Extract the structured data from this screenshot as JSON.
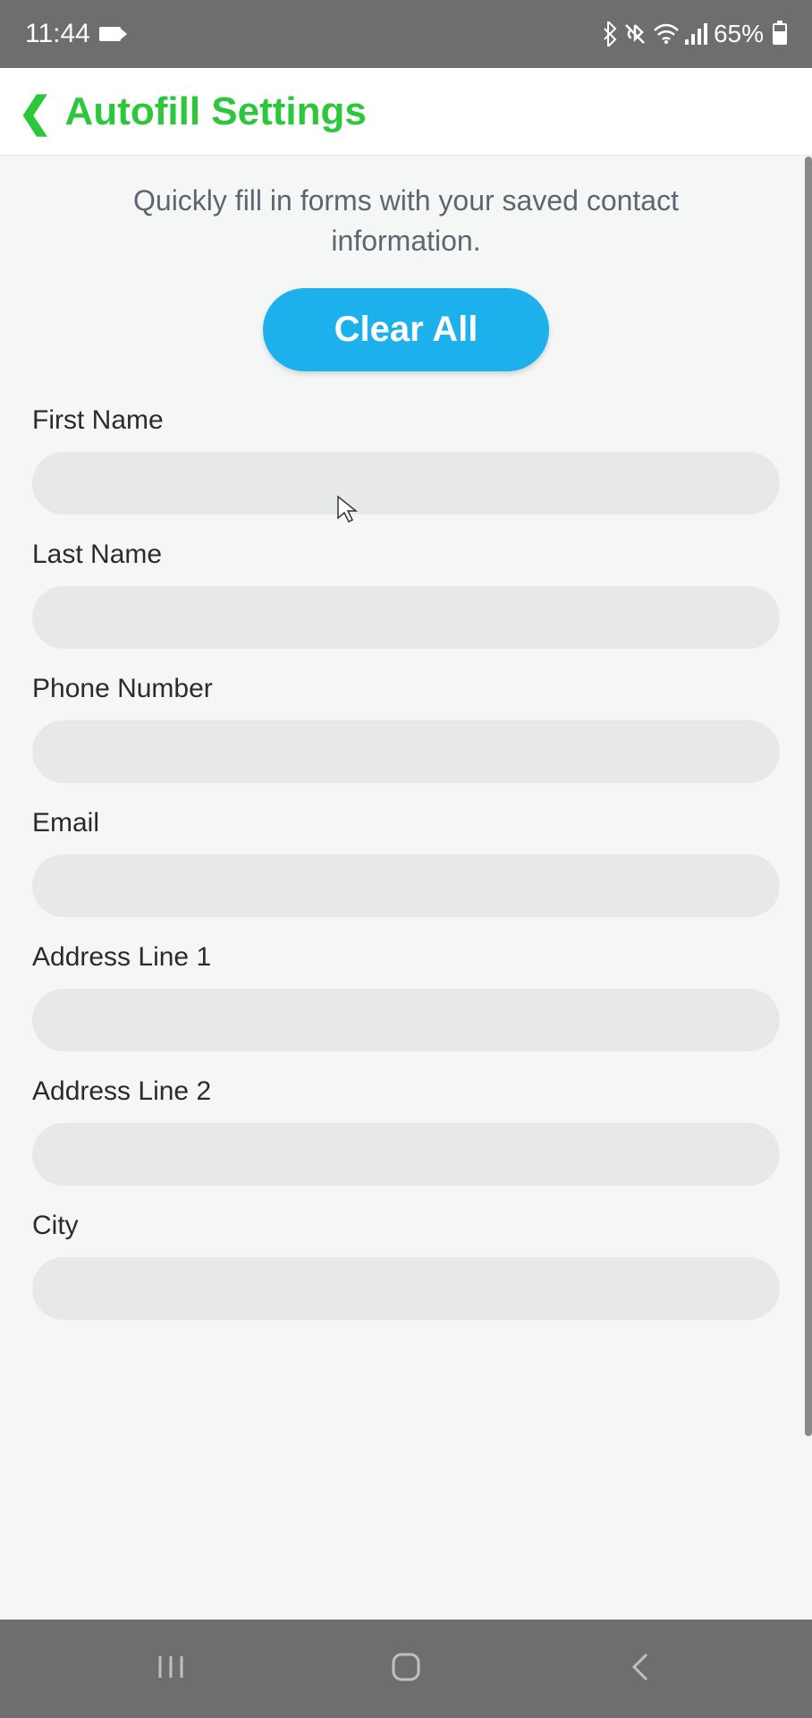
{
  "statusBar": {
    "time": "11:44",
    "batteryPercent": "65%"
  },
  "header": {
    "title": "Autofill Settings"
  },
  "content": {
    "description": "Quickly fill in forms with your saved contact information.",
    "clearButton": "Clear All",
    "fields": [
      {
        "label": "First Name",
        "value": ""
      },
      {
        "label": "Last Name",
        "value": ""
      },
      {
        "label": "Phone Number",
        "value": ""
      },
      {
        "label": "Email",
        "value": ""
      },
      {
        "label": "Address Line 1",
        "value": ""
      },
      {
        "label": "Address Line 2",
        "value": ""
      },
      {
        "label": "City",
        "value": ""
      }
    ]
  }
}
